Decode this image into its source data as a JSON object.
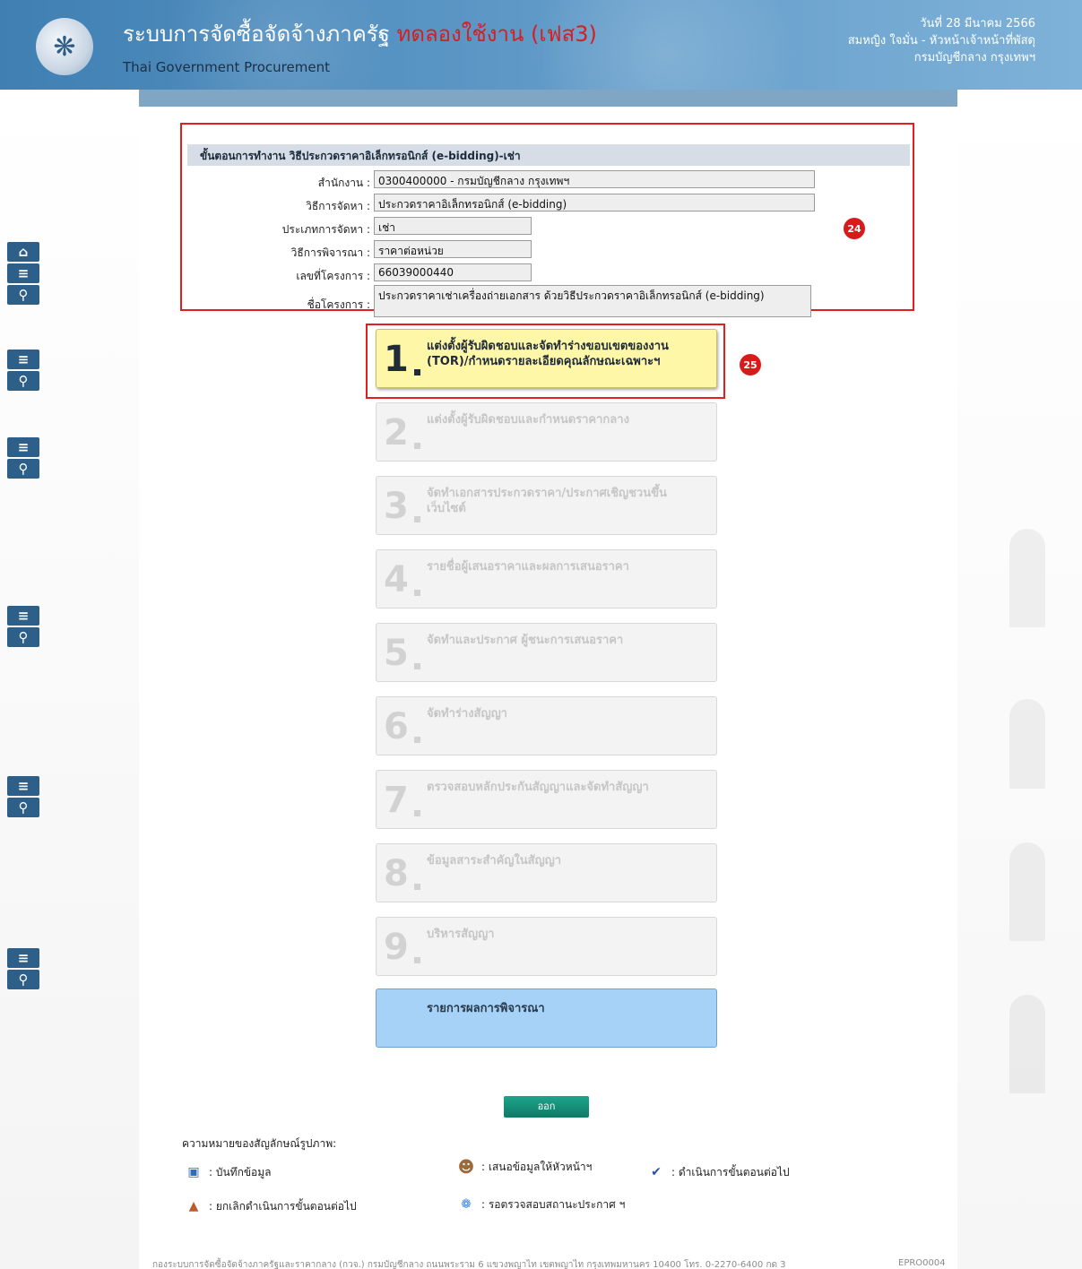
{
  "header": {
    "title": "ระบบการจัดซื้อจัดจ้างภาครัฐ",
    "trial_label": "ทดลองใช้งาน (เฟส3)",
    "subtitle": "Thai Government Procurement",
    "date": "วันที่ 28 มีนาคม 2566",
    "user": "สมหญิง ใจมั่น - หัวหน้าเจ้าหน้าที่พัสดุ",
    "org": "กรมบัญชีกลาง กรุงเทพฯ",
    "logo_icon": "garuda-logo"
  },
  "info": {
    "heading": "ขั้นตอนการทำงาน วิธีประกวดราคาอิเล็กทรอนิกส์ (e-bidding)-เช่า",
    "agency_label": "สำนักงาน :",
    "agency_value": "0300400000 - กรมบัญชีกลาง กรุงเทพฯ",
    "method_label": "วิธีการจัดหา :",
    "method_value": "ประกวดราคาอิเล็กทรอนิกส์ (e-bidding)",
    "type_label": "ประเภทการจัดหา :",
    "type_value": "เช่า",
    "criteria_label": "วิธีการพิจารณา :",
    "criteria_value": "ราคาต่อหน่วย",
    "project_no_label": "เลขที่โครงการ :",
    "project_no_value": "66039000440",
    "project_name_label": "ชื่อโครงการ :",
    "project_name_value": "ประกวดราคาเช่าเครื่องถ่ายเอกสาร ด้วยวิธีประกวดราคาอิเล็กทรอนิกส์ (e-bidding)",
    "badge": "24"
  },
  "steps": [
    {
      "num": "1",
      "label": "แต่งตั้งผู้รับผิดชอบและจัดทำร่างขอบเขตของงาน (TOR)/กำหนดรายละเอียดคุณลักษณะเฉพาะฯ"
    },
    {
      "num": "2",
      "label": "แต่งตั้งผู้รับผิดชอบและกำหนดราคากลาง"
    },
    {
      "num": "3",
      "label": "จัดทำเอกสารประกวดราคา/ประกาศเชิญชวนขึ้นเว็บไซต์"
    },
    {
      "num": "4",
      "label": "รายชื่อผู้เสนอราคาและผลการเสนอราคา"
    },
    {
      "num": "5",
      "label": "จัดทำและประกาศ ผู้ชนะการเสนอราคา"
    },
    {
      "num": "6",
      "label": "จัดทำร่างสัญญา"
    },
    {
      "num": "7",
      "label": "ตรวจสอบหลักประกันสัญญาและจัดทำสัญญา"
    },
    {
      "num": "8",
      "label": "ข้อมูลสาระสำคัญในสัญญา"
    },
    {
      "num": "9",
      "label": "บริหารสัญญา"
    }
  ],
  "step_badge": "25",
  "result_label": "รายการผลการพิจารณา",
  "exit_label": "ออก",
  "legend": {
    "title": "ความหมายของสัญลักษณ์รูปภาพ:",
    "save": ": บันทึกข้อมูล",
    "propose": ": เสนอข้อมูลให้หัวหน้าฯ",
    "next": ": ดำเนินการขั้นตอนต่อไป",
    "cancel": ": ยกเลิกดำเนินการขั้นตอนต่อไป",
    "wait": ": รอตรวจสอบสถานะประกาศ ฯ"
  },
  "footer": {
    "text": "กองระบบการจัดซื้อจัดจ้างภาครัฐและราคากลาง (กวจ.) กรมบัญชีกลาง ถนนพระราม 6 แขวงพญาไท เขตพญาไท กรุงเทพมหานคร 10400 โทร. 0-2270-6400 กด 3",
    "code": "EPRO0004"
  }
}
